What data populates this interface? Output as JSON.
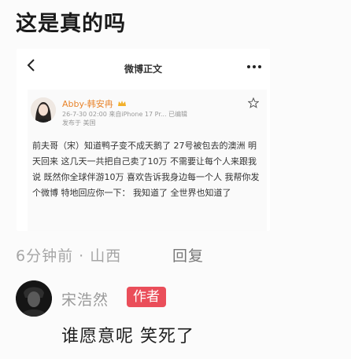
{
  "question": "这是真的吗",
  "screenshot": {
    "nav_title": "微博正文",
    "icons": {
      "back": "back-arrow-icon",
      "more": "more-dots-icon",
      "favorite": "star-icon",
      "vip": "vip-crown-icon"
    },
    "post": {
      "author": "Abby-韩安冉",
      "meta": "26-7-30 02:00  来自iPhone 17 Pr...  已编辑",
      "source": "发布于 美国",
      "body": "前夫哥（宋）知道鸭子变不成天鹅了 27号被包去的澳洲 明天回来 这几天一共把自己卖了10万 不需要让每个人来跟我说 既然你全球伴游10万 喜欢告诉我身边每一个人 我帮你发个微博 特地回应你一下： 我知道了 全世界也知道了"
    }
  },
  "comment": {
    "time_location": "6分钟前 · 山西",
    "reply_label": "回复"
  },
  "reply": {
    "username": "宋浩然",
    "badge": "作者",
    "text": "谁愿意呢 笑死了"
  },
  "colors": {
    "author_name": "#e8832a",
    "badge_bg": "#ea4e5a",
    "muted_text": "#a6a6a6"
  }
}
